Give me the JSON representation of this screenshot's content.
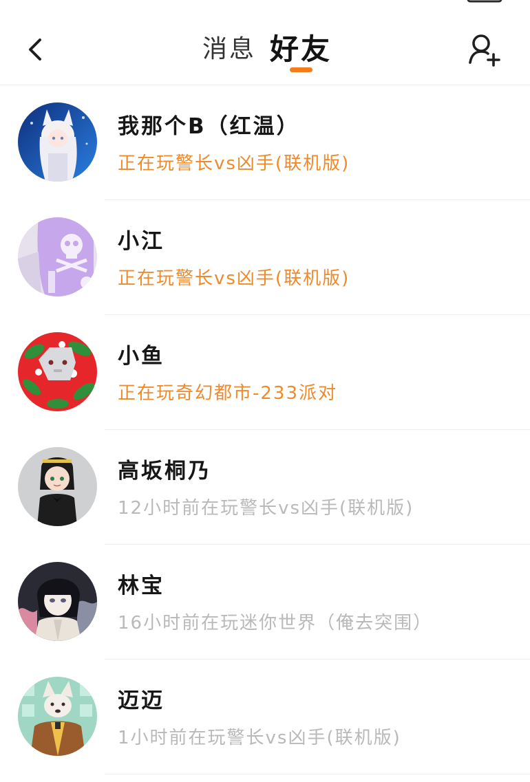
{
  "nav": {
    "tabs": [
      {
        "label": "消息",
        "active": false
      },
      {
        "label": "好友",
        "active": true
      }
    ],
    "back_icon": "chevron-left-icon",
    "add_friend_icon": "add-user-icon"
  },
  "colors": {
    "accent": "#f37c1d",
    "online_status": "#ef8a2b",
    "offline_status": "#b9b9b9"
  },
  "friends": [
    {
      "name": "我那个B（红温）",
      "status": "正在玩警长vs凶手(联机版)",
      "online": true
    },
    {
      "name": "小江",
      "status": "正在玩警长vs凶手(联机版)",
      "online": true
    },
    {
      "name": "小鱼",
      "status": "正在玩奇幻都市-233派对",
      "online": true
    },
    {
      "name": "高坂桐乃",
      "status": "12小时前在玩警长vs凶手(联机版)",
      "online": false
    },
    {
      "name": "林宝",
      "status": "16小时前在玩迷你世界（俺去突围）",
      "online": false
    },
    {
      "name": "迈迈",
      "status": "1小时前在玩警长vs凶手(联机版)",
      "online": false
    }
  ]
}
